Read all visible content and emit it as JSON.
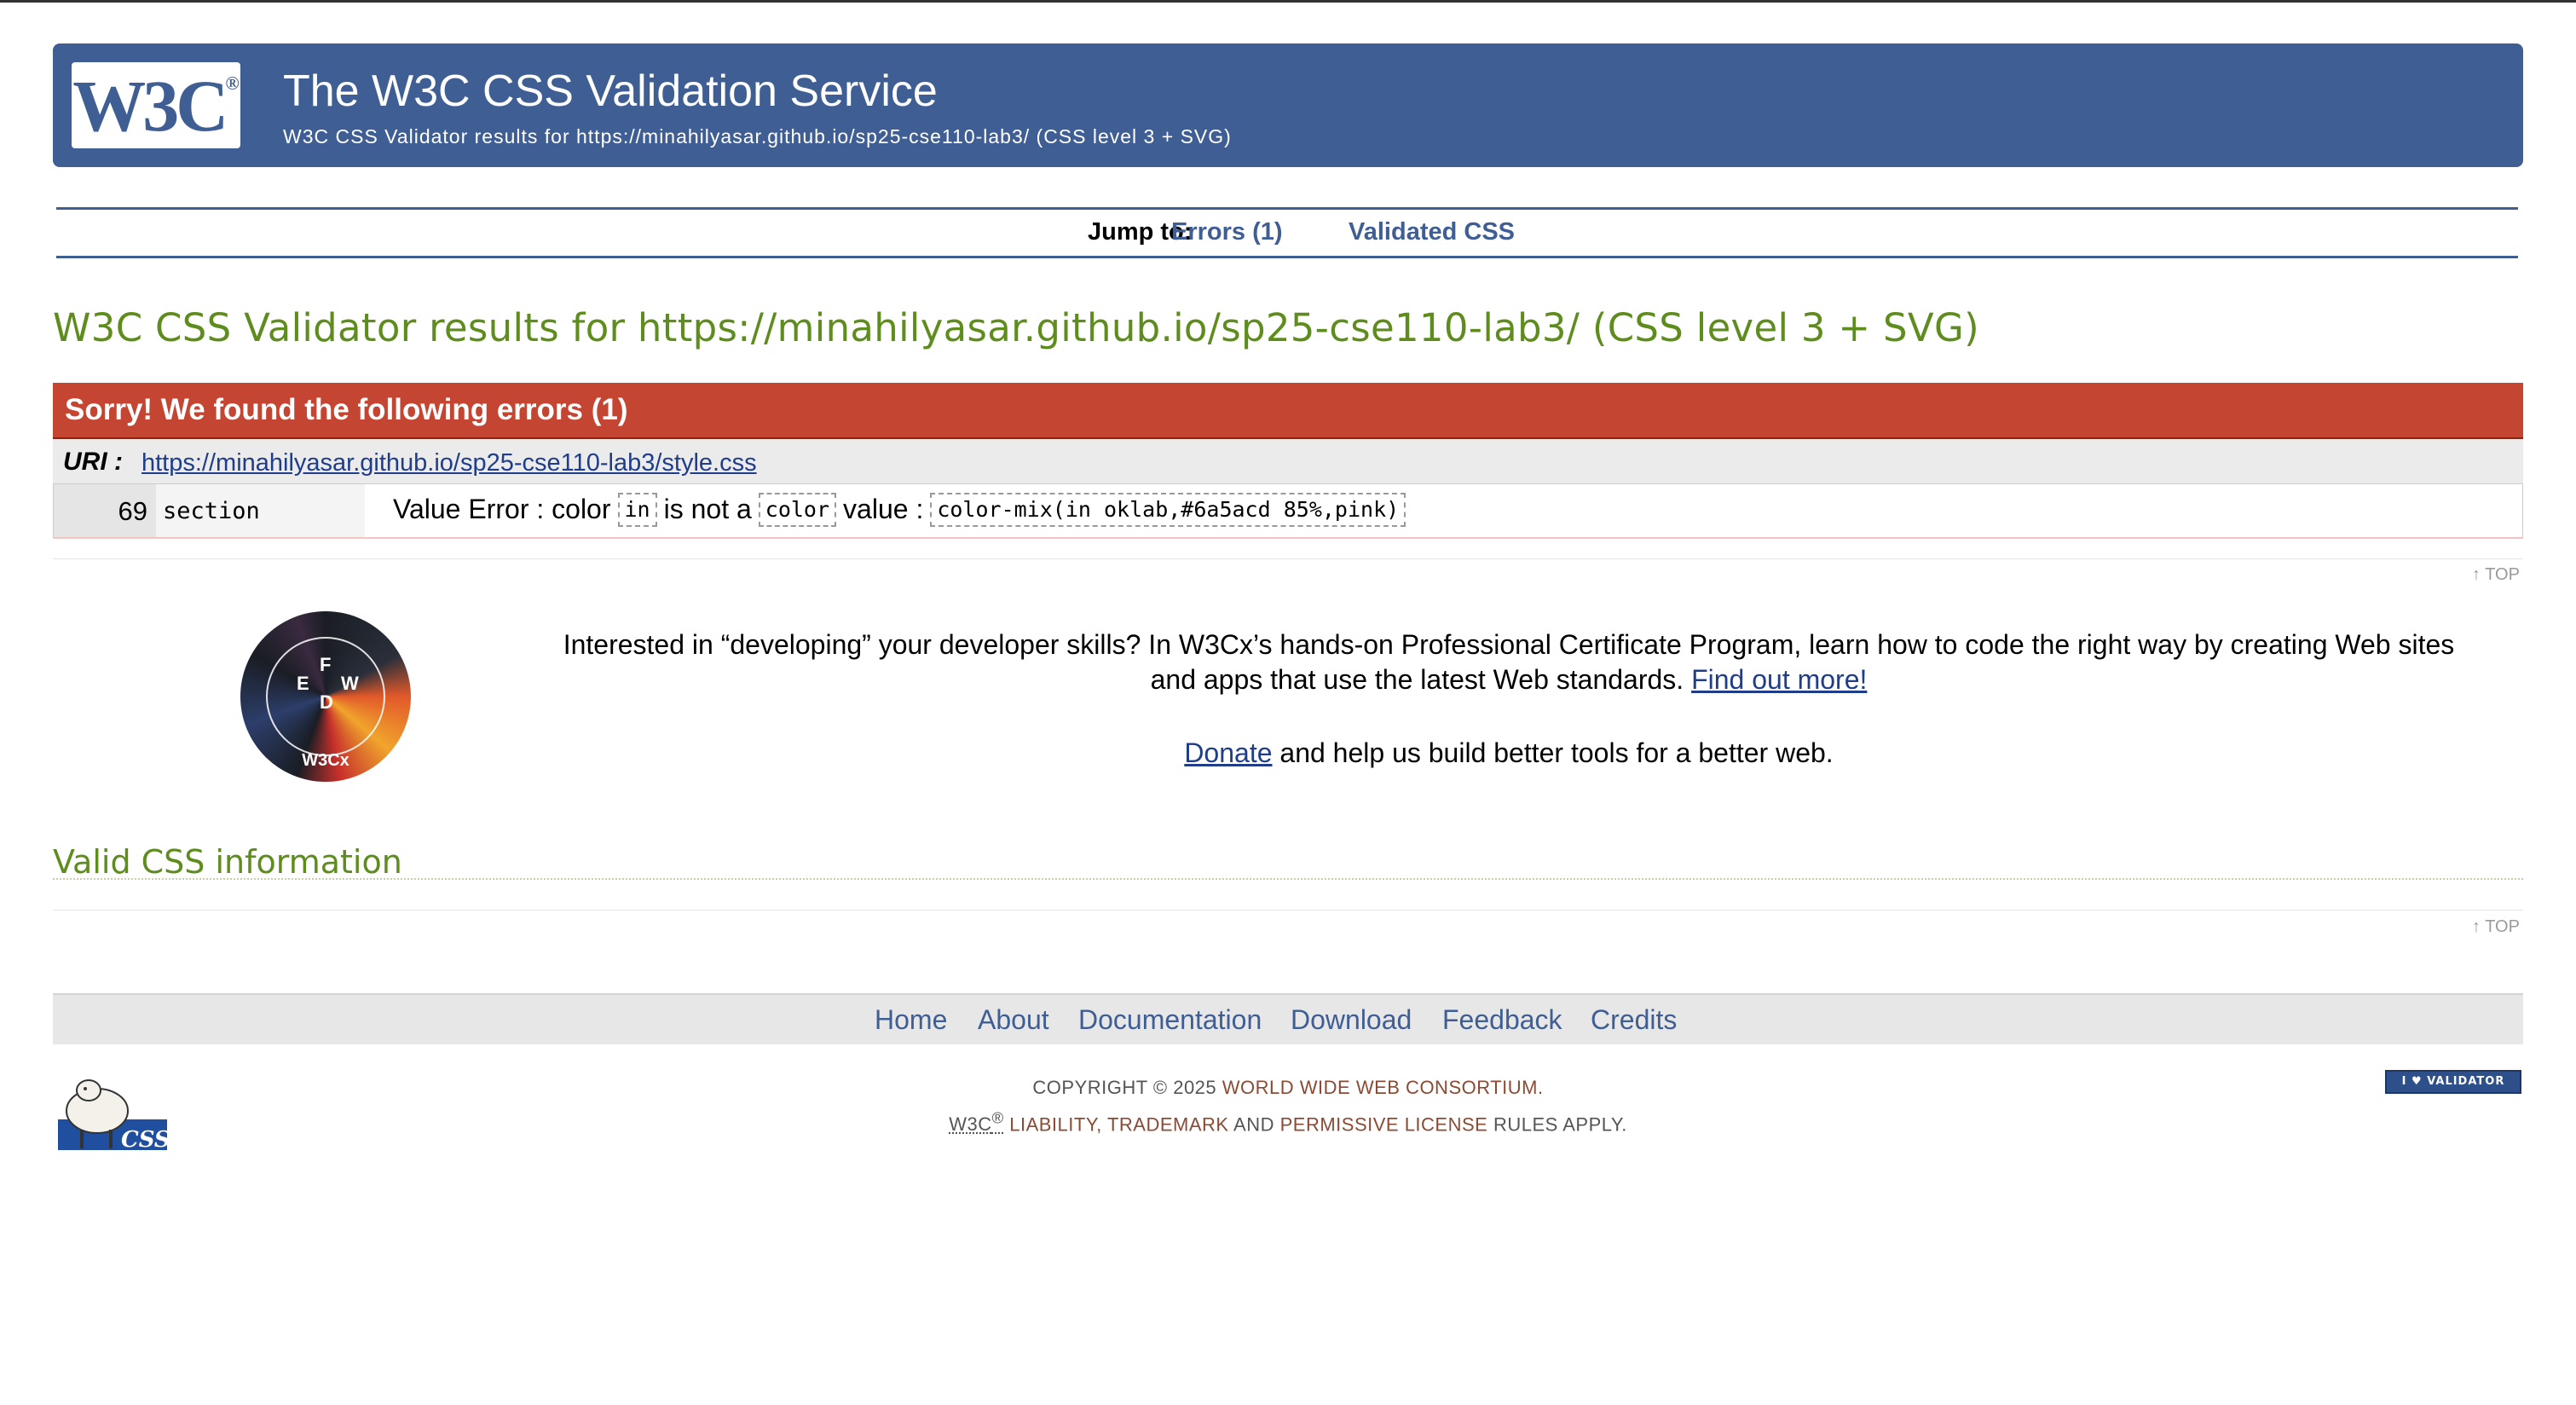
{
  "banner": {
    "title": "The W3C CSS Validation Service",
    "subtitle": "W3C CSS Validator results for https://minahilyasar.github.io/sp25-cse110-lab3/ (CSS level 3 + SVG)",
    "logo_text": "W3C",
    "logo_mark": "®"
  },
  "jump": {
    "label": "Jump to:",
    "links": [
      "Errors (1)",
      "Validated CSS"
    ]
  },
  "result_heading": "W3C CSS Validator results for https://minahilyasar.github.io/sp25-cse110-lab3/ (CSS level 3 + SVG)",
  "errors": {
    "title": "Sorry! We found the following errors (1)",
    "uri_label": "URI :",
    "uri": "https://minahilyasar.github.io/sp25-cse110-lab3/style.css",
    "rows": [
      {
        "line": "69",
        "context": "section",
        "msg_prefix": "Value Error : color",
        "code1": "in",
        "msg_mid": "is not a",
        "code2": "color",
        "msg_suffix": "value :",
        "code3": "color-mix(in oklab,#6a5acd 85%,pink)"
      }
    ]
  },
  "top_link": "↑ TOP",
  "promo": {
    "text": "Interested in “developing” your developer skills? In W3Cx’s hands-on Professional Certificate Program, learn how to code the right way by creating Web sites and apps that use the latest Web standards.",
    "link": "Find out more!",
    "donate_link": "Donate",
    "donate_text": "and help us build better tools for a better web.",
    "badge": {
      "letters": [
        "F",
        "E",
        "W",
        "D"
      ],
      "caption": "W3Cx"
    }
  },
  "valid_heading": "Valid CSS information",
  "footer": {
    "nav": [
      "Home",
      "About",
      "Documentation",
      "Download",
      "Feedback",
      "Credits"
    ],
    "copyright_prefix": "COPYRIGHT © 2025",
    "consortium": "WORLD WIDE WEB CONSORTIUM.",
    "w3c": "W3C",
    "w3c_mark": "®",
    "liability": "LIABILITY,",
    "trademark": "TRADEMARK",
    "and": "AND",
    "license": "PERMISSIVE LICENSE",
    "rules": "RULES APPLY.",
    "badge_text": "I ♥ VALIDATOR",
    "sheep_label": "CSS"
  },
  "colors": {
    "banner": "#3e5e94",
    "heading_green": "#5e8d1e",
    "error_red": "#c44632",
    "link_blue": "#1f3d8a"
  }
}
